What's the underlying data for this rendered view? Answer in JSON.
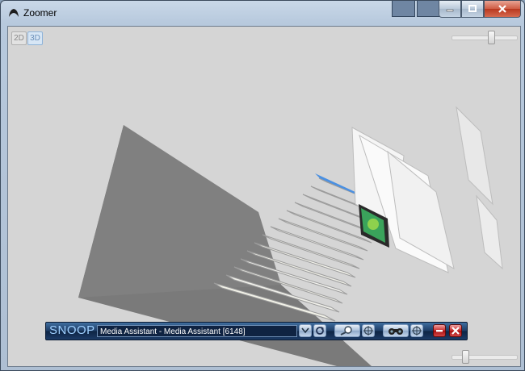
{
  "window": {
    "title": "Zoomer"
  },
  "toolbar": {
    "mode_2d": "2D",
    "mode_3d": "3D",
    "active_mode": "3D"
  },
  "snoop": {
    "logo": "SNOOP",
    "target": "Media Assistant - Media Assistant [6148]"
  }
}
